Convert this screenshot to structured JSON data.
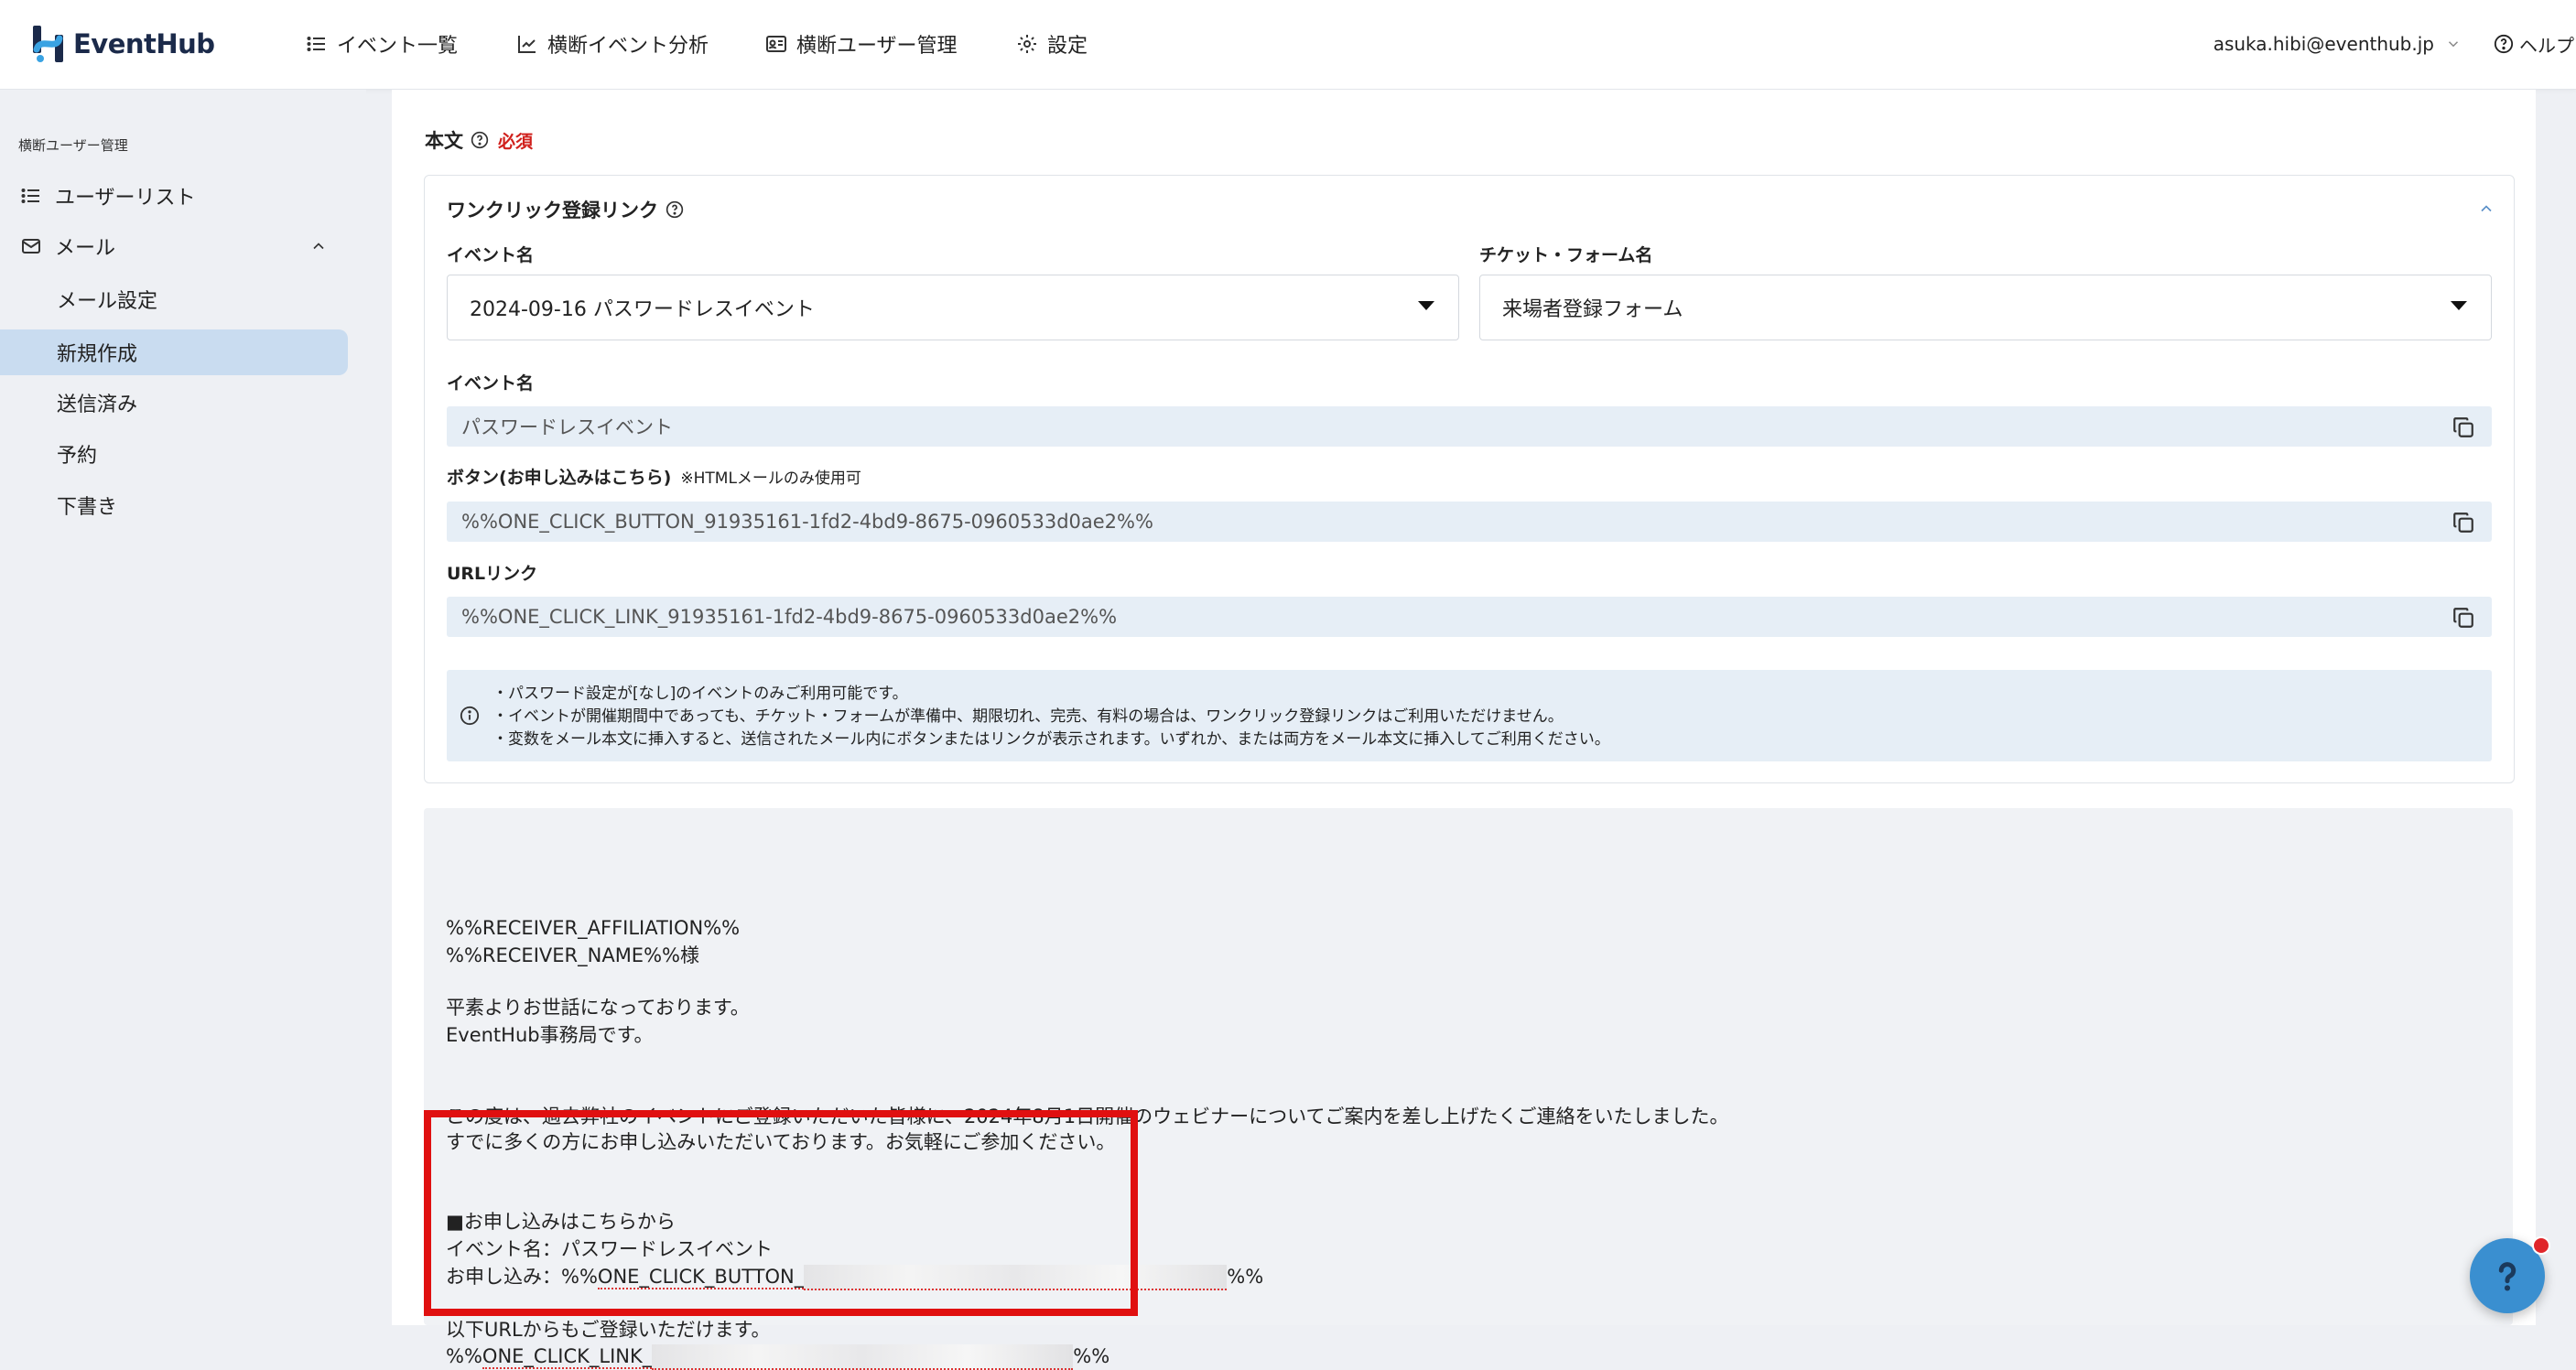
{
  "app": {
    "brand": "EventHub"
  },
  "nav": [
    {
      "label": "イベント一覧",
      "icon": "list-icon"
    },
    {
      "label": "横断イベント分析",
      "icon": "chart-icon"
    },
    {
      "label": "横断ユーザー管理",
      "icon": "id-card-icon"
    },
    {
      "label": "設定",
      "icon": "gear-icon"
    }
  ],
  "user": {
    "email": "asuka.hibi@eventhub.jp",
    "help": "ヘルプ"
  },
  "sidebar": {
    "section": "横断ユーザー管理",
    "items": [
      {
        "label": "ユーザーリスト",
        "icon": "list-icon"
      },
      {
        "label": "メール",
        "icon": "mail-icon"
      }
    ],
    "sub_items": [
      {
        "label": "メール設定",
        "active": false
      },
      {
        "label": "新規作成",
        "active": true
      },
      {
        "label": "送信済み",
        "active": false
      },
      {
        "label": "予約",
        "active": false
      },
      {
        "label": "下書き",
        "active": false
      }
    ]
  },
  "editor": {
    "body_label": "本文",
    "required": "必須",
    "one_click": {
      "title": "ワンクリック登録リンク",
      "event_select_label": "イベント名",
      "event_select_value": "2024-09-16 パスワードレスイベント",
      "form_select_label": "チケット・フォーム名",
      "form_select_value": "来場者登録フォーム",
      "event_name_label": "イベント名",
      "event_name_value": "パスワードレスイベント",
      "button_label": "ボタン(お申し込みはこちら)",
      "button_note": "※HTMLメールのみ使用可",
      "button_value": "%%ONE_CLICK_BUTTON_91935161-1fd2-4bd9-8675-0960533d0ae2%%",
      "url_label": "URLリンク",
      "url_value": "%%ONE_CLICK_LINK_91935161-1fd2-4bd9-8675-0960533d0ae2%%",
      "info": [
        "・パスワード設定が[なし]のイベントのみご利用可能です。",
        "・イベントが開催期間中であっても、チケット・フォームが準備中、期限切れ、完売、有料の場合は、ワンクリック登録リンクはご利用いただけません。",
        "・変数をメール本文に挿入すると、送信されたメール内にボタンまたはリンクが表示されます。いずれか、または両方をメール本文に挿入してご利用ください。"
      ]
    },
    "body": {
      "line1": "%%RECEIVER_AFFILIATION%%",
      "line2": "%%RECEIVER_NAME%%様",
      "line3": "平素よりお世話になっております。",
      "line4": "EventHub事務局です。",
      "line5": "この度は、過去弊社のイベントにご登録いただいた皆様に、2024年8月1日開催のウェビナーについてご案内を差し上げたくご連絡をいたしました。",
      "line6": "すでに多くの方にお申し込みいただいております。お気軽にご参加ください。",
      "line7": "■お申し込みはこちらから",
      "line8": "イベント名：パスワードレスイベント",
      "line9_prefix": "お申し込み：%%",
      "line9_link": "ONE_CLICK_BUTTON_",
      "line9_suffix": "%%",
      "line10": "以下URLからもご登録いただけます。",
      "line11_prefix": "%%",
      "line11_link": "ONE_CLICK_LINK_",
      "line11_suffix": "%%"
    }
  },
  "colors": {
    "accent": "#3a8fd0",
    "active_nav": "#c9dcf0",
    "highlight": "#e01010",
    "required": "#d0201c"
  }
}
